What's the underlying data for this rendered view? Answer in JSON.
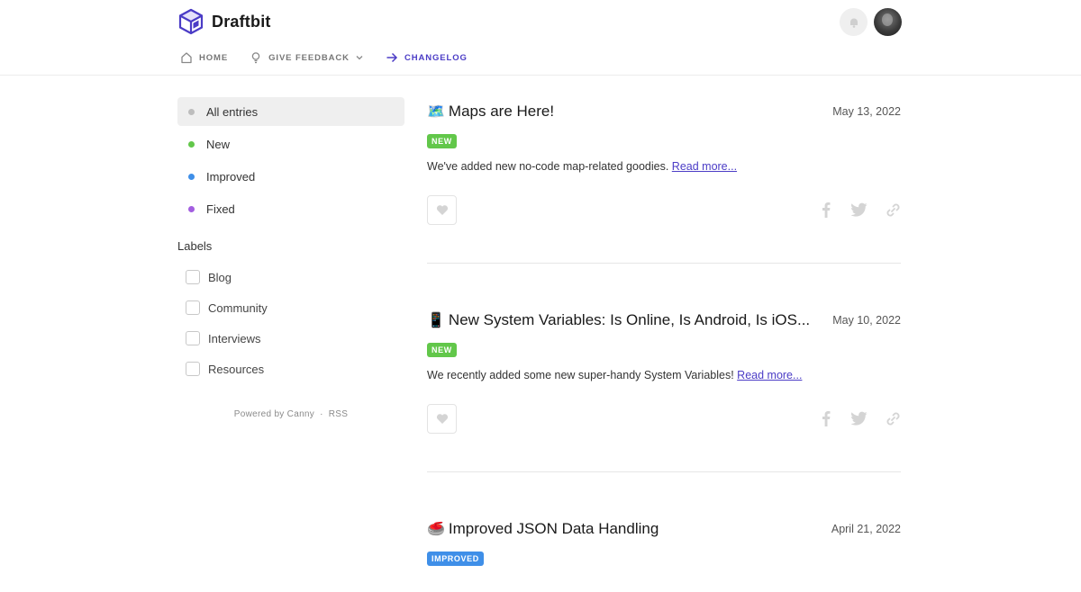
{
  "brand": {
    "name": "Draftbit",
    "accent": "#4b3cc6"
  },
  "nav": {
    "home": "HOME",
    "feedback": "GIVE FEEDBACK",
    "changelog": "CHANGELOG"
  },
  "sidebar": {
    "filters": [
      {
        "label": "All entries",
        "color": "#bdbdbd"
      },
      {
        "label": "New",
        "color": "#62c74a"
      },
      {
        "label": "Improved",
        "color": "#3f8fe8"
      },
      {
        "label": "Fixed",
        "color": "#a35ee0"
      }
    ],
    "labels_title": "Labels",
    "labels": [
      "Blog",
      "Community",
      "Interviews",
      "Resources"
    ],
    "powered_by": "Powered by Canny",
    "separator": "·",
    "rss": "RSS"
  },
  "entries": [
    {
      "emoji": "🗺️",
      "title": "Maps are Here!",
      "date": "May 13, 2022",
      "badge": "NEW",
      "body": "We've added new no-code map-related goodies.",
      "read_more": "Read more..."
    },
    {
      "emoji": "📱",
      "title": "New System Variables: Is Online, Is Android, Is iOS...",
      "date": "May 10, 2022",
      "badge": "NEW",
      "body": "We recently added some new super-handy System Variables!",
      "read_more": "Read more..."
    },
    {
      "emoji": "🥌",
      "title": "Improved JSON Data Handling",
      "date": "April 21, 2022",
      "badge": "IMPROVED"
    }
  ]
}
